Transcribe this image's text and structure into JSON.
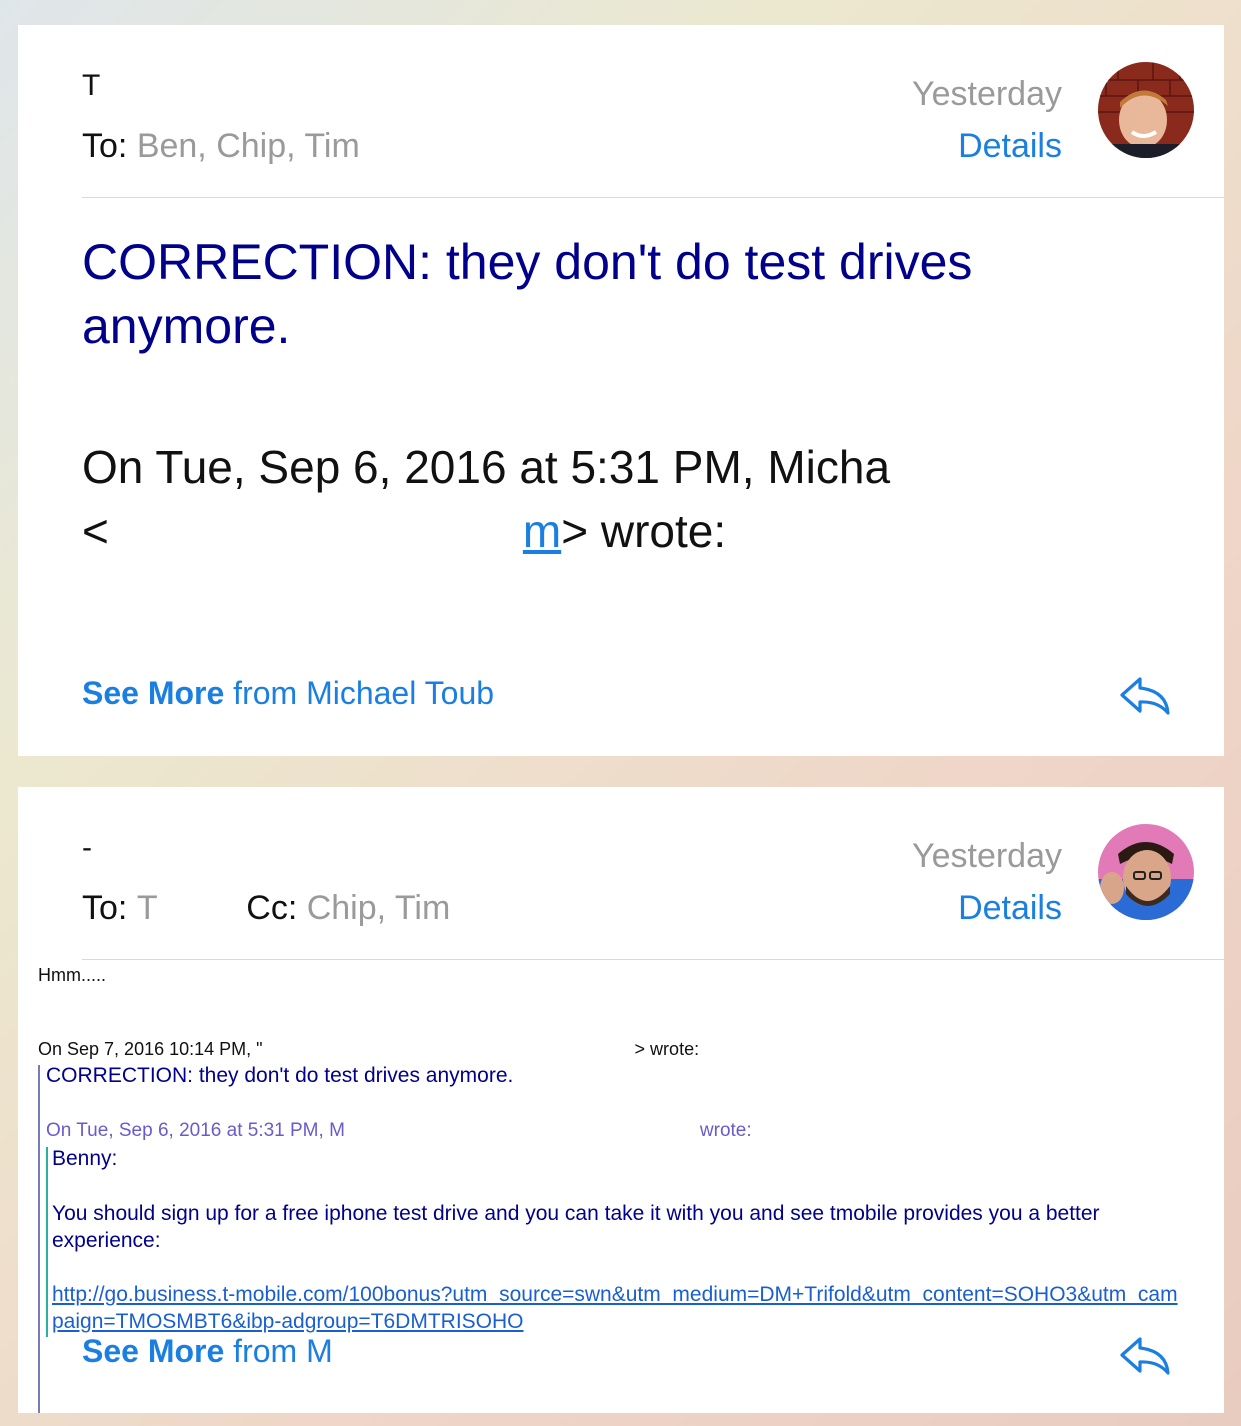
{
  "message1": {
    "sender": "T",
    "date": "Yesterday",
    "to_label": "To:",
    "to_names": "Ben, Chip, Tim",
    "details": "Details",
    "subject": "CORRECTION: they don't do test drives anymore.",
    "quote_line1": "On Tue, Sep 6, 2016 at 5:31 PM, Micha",
    "quote_lt": "<",
    "quote_link": "m",
    "quote_wrote": "> wrote:",
    "see_more_bold": "See More",
    "see_more_rest": "from Michael Toub"
  },
  "message2": {
    "sender": "-",
    "date": "Yesterday",
    "to_label": "To:",
    "to_names": "T",
    "cc_label": "Cc:",
    "cc_names": "Chip, Tim",
    "details": "Details",
    "hmm": "Hmm.....",
    "on_sep7": "On Sep 7, 2016 10:14 PM, \"",
    "on_sep7_link": "",
    "on_sep7_wrote": "> wrote:",
    "correction": "CORRECTION: they don't do test drives anymore.",
    "on_sep6": "On Tue, Sep 6, 2016 at 5:31 PM, M",
    "on_sep6_wrote": "wrote:",
    "benny": "Benny:",
    "paragraph": "You should sign up for a free iphone test drive and you can take it with you and see tmobile provides you a better experience:",
    "url": "http://go.business.t-mobile.com/100bonus?utm_source=swn&utm_medium=DM+Trifold&utm_content=SOHO3&utm_campaign=TMOSMBT6&ibp-adgroup=T6DMTRISOHO",
    "see_more_bold": "See More",
    "see_more_rest": "from M"
  },
  "colors": {
    "accent": "#1a7fe0",
    "subject_navy": "#00008b",
    "muted": "#9a9a9a"
  },
  "icons": [
    "avatar",
    "reply-arrow-icon"
  ]
}
